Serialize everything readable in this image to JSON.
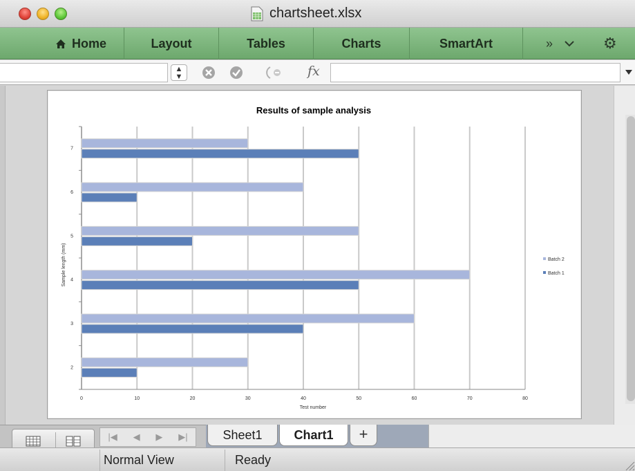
{
  "window": {
    "title": "chartsheet.xlsx"
  },
  "ribbon": {
    "tabs": [
      "Home",
      "Layout",
      "Tables",
      "Charts",
      "SmartArt"
    ],
    "overflow_label": "»",
    "more_label": "⌄",
    "gear_label": "⚙"
  },
  "formula_bar": {
    "fx_label": "fx",
    "name_box_value": "",
    "formula_value": ""
  },
  "sheet_tabs": [
    "Sheet1",
    "Chart1"
  ],
  "sheet_add_label": "+",
  "status": {
    "view": "Normal View",
    "state": "Ready"
  },
  "colors": {
    "ribbon": "#7fb67f",
    "batch2": "#a8b6dc",
    "batch1": "#5b7fb8"
  },
  "chart_data": {
    "type": "bar",
    "orientation": "horizontal",
    "title": "Results of sample analysis",
    "xlabel": "Test number",
    "ylabel": "Sample length (mm)",
    "categories": [
      "2",
      "3",
      "4",
      "5",
      "6",
      "7"
    ],
    "series": [
      {
        "name": "Batch 1",
        "values": [
          10,
          40,
          50,
          20,
          10,
          50
        ],
        "color": "#5b7fb8"
      },
      {
        "name": "Batch 2",
        "values": [
          30,
          60,
          70,
          50,
          40,
          30
        ],
        "color": "#a8b6dc"
      }
    ],
    "xlim": [
      0,
      80
    ],
    "xticks": [
      0,
      10,
      20,
      30,
      40,
      50,
      60,
      70,
      80
    ],
    "grid": "vertical",
    "legend": "right",
    "legend_order": [
      "Batch 2",
      "Batch 1"
    ]
  }
}
